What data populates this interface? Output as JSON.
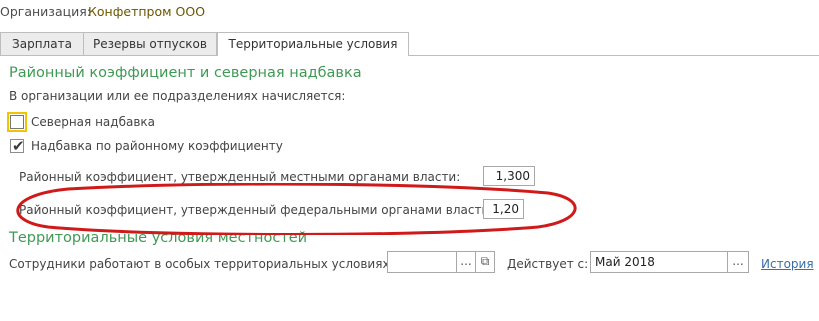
{
  "header": {
    "org_label": "Организация:",
    "org_value": "Конфетпром ООО"
  },
  "tabs": [
    {
      "label": "Зарплата",
      "active": false
    },
    {
      "label": "Резервы отпусков",
      "active": false
    },
    {
      "label": "Территориальные условия",
      "active": true
    }
  ],
  "section1": {
    "title": "Районный коэффициент и северная надбавка",
    "subtitle": "В организации или ее подразделениях начисляется:",
    "north_bonus": {
      "label": "Северная надбавка",
      "checked": false
    },
    "regional_bonus": {
      "label": "Надбавка по районному коэффициенту",
      "checked": true
    },
    "local_coef": {
      "label": "Районный коэффициент, утвержденный местными органами власти:",
      "value": "1,300"
    },
    "federal_coef": {
      "label": "Районный коэффициент, утвержденный федеральными органами власти:",
      "value": "1,20"
    }
  },
  "section2": {
    "title": "Территориальные условия местностей",
    "employees_label": "Сотрудники работают в особых территориальных условиях:",
    "employees_value": "",
    "select_button": "...",
    "open_button": "⧉",
    "valid_from_label": "Действует с:",
    "valid_from_value": "Май 2018",
    "date_button": "...",
    "history_link": "История"
  },
  "colors": {
    "section_title": "#3f9a54",
    "org_link": "#6b5500",
    "annotation_oval": "#d01a1a",
    "history_link": "#3a6ea8"
  }
}
